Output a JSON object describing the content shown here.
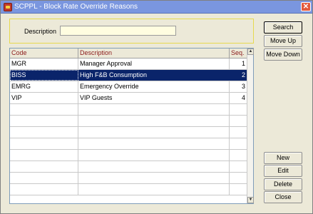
{
  "window": {
    "title": "SCPPL - Block Rate Override Reasons",
    "close_glyph": "✕"
  },
  "search": {
    "description_label": "Description",
    "description_value": ""
  },
  "grid": {
    "columns": {
      "code": "Code",
      "description": "Description",
      "seq": "Seq."
    },
    "rows": [
      {
        "code": "MGR",
        "description": "Manager Approval",
        "seq": "1"
      },
      {
        "code": "BISS",
        "description": "High F&B Consumption",
        "seq": "2"
      },
      {
        "code": "EMRG",
        "description": "Emergency Override",
        "seq": "3"
      },
      {
        "code": "VIP",
        "description": "VIP Guests",
        "seq": "4"
      }
    ],
    "selected_index": 1
  },
  "buttons": {
    "search": "Search",
    "move_up": "Move Up",
    "move_down": "Move Down",
    "new": "New",
    "edit": "Edit",
    "delete": "Delete",
    "close": "Close"
  },
  "colors": {
    "selection": "#0a246a",
    "header_text": "#8b1a1a",
    "title_bar": "#7a96df",
    "panel_border": "#e6d94e",
    "input_bg": "#fffde0"
  }
}
